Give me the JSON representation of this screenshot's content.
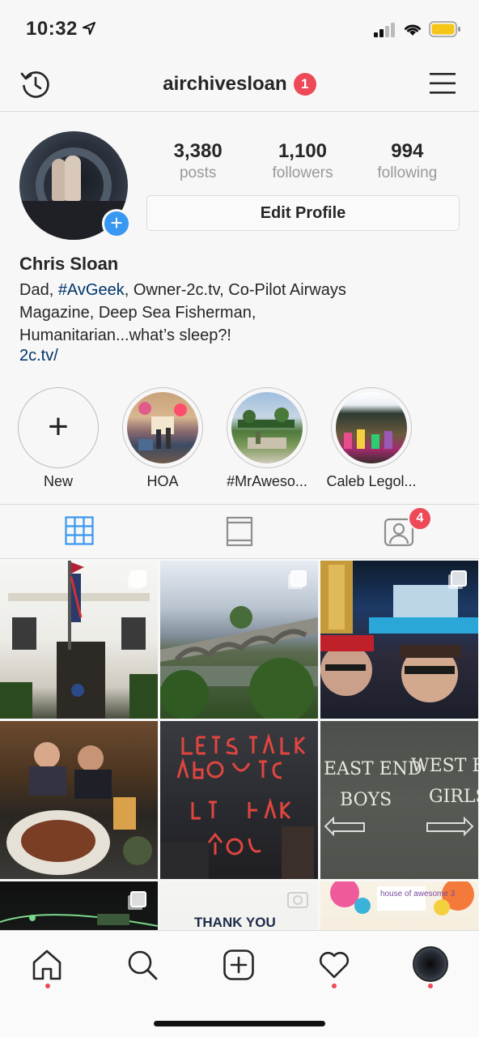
{
  "status_bar": {
    "time": "10:32",
    "battery_color": "#f5c518"
  },
  "header": {
    "username": "airchivesloan",
    "notification_count": "1",
    "accent_red": "#ed4956"
  },
  "profile": {
    "stats": [
      {
        "value": "3,380",
        "label": "posts"
      },
      {
        "value": "1,100",
        "label": "followers"
      },
      {
        "value": "994",
        "label": "following"
      }
    ],
    "edit_button": "Edit Profile",
    "full_name": "Chris Sloan",
    "bio_line1_start": "Dad, ",
    "bio_hashtag": "#AvGeek",
    "bio_line1_end": ", Owner-2c.tv, Co-Pilot Airways",
    "bio_line2": "Magazine, Deep Sea Fisherman,",
    "bio_line3": "Humanitarian...what’s sleep?!",
    "link": "2c.tv/"
  },
  "highlights": [
    {
      "label": "New",
      "icon": "plus-icon"
    },
    {
      "label": "HOA"
    },
    {
      "label": "#MrAweso..."
    },
    {
      "label": "Caleb Legol..."
    }
  ],
  "tabs": {
    "grid": "grid-icon",
    "feed": "feed-icon",
    "tagged": "tagged-icon",
    "tagged_badge": "4",
    "active_color": "#3897f0"
  },
  "posts": [
    {
      "alt": "hotel facade",
      "multi": true
    },
    {
      "alt": "bridge over river",
      "multi": true
    },
    {
      "alt": "selfie at show",
      "multi": true
    },
    {
      "alt": "dinner with steak",
      "multi": false
    },
    {
      "alt": "neon sign wall",
      "multi": false
    },
    {
      "alt": "chalkboard sign",
      "multi": false,
      "line1_left": "EAST END",
      "line1_right": "WEST END",
      "line2_left": "BOYS",
      "line2_right": "GIRLS"
    },
    {
      "alt": "cockpit night",
      "multi": true
    },
    {
      "alt": "thank you card",
      "multi": false,
      "text": "THANK YOU"
    },
    {
      "alt": "house of awesome",
      "multi": false,
      "text": "house of awesome 3"
    }
  ],
  "tab_bar": {
    "items": [
      "home-icon",
      "search-icon",
      "new-post-icon",
      "activity-icon",
      "profile-icon"
    ]
  }
}
